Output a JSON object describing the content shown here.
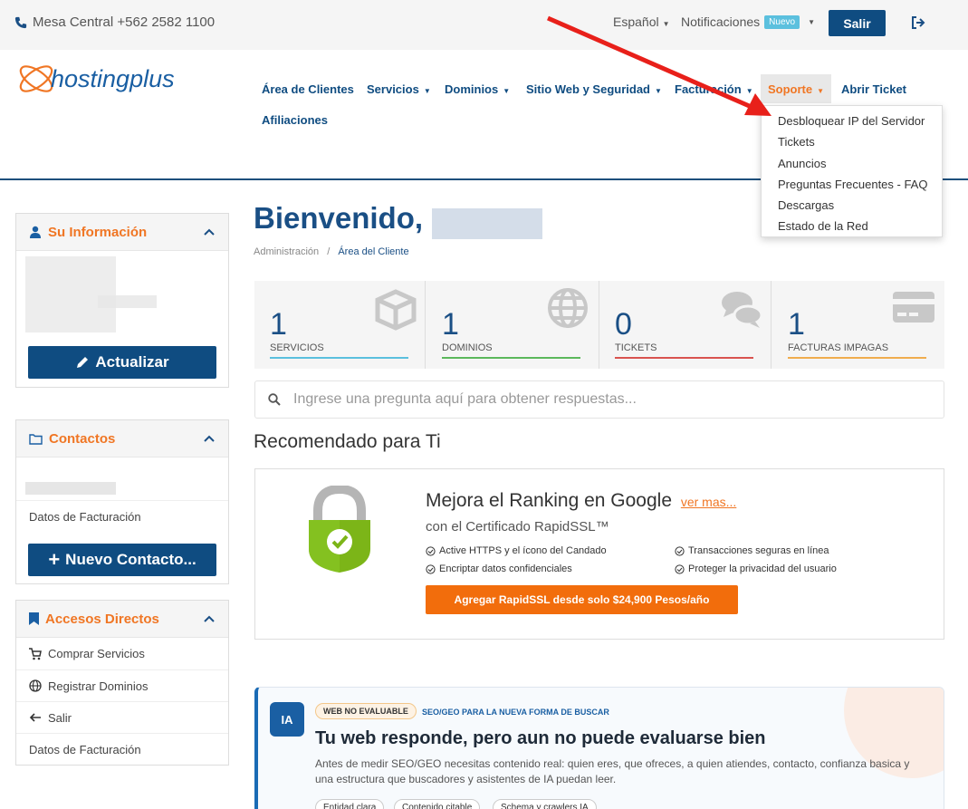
{
  "topbar": {
    "phone": "Mesa Central +562 2582 1100",
    "language": "Español",
    "notifications": "Notificaciones",
    "badge": "Nuevo",
    "logout_button": "Salir"
  },
  "brand": {
    "logo_text": "hostingplus",
    "logo_color": "#f07624"
  },
  "nav": {
    "items": [
      "Área de Clientes",
      "Servicios",
      "Dominios",
      "Sitio Web y Seguridad",
      "Facturación",
      "Soporte",
      "Abrir Ticket",
      "Afiliaciones"
    ],
    "active": "Soporte"
  },
  "dropdown": {
    "items": [
      "Desbloquear IP del Servidor",
      "Tickets",
      "Anuncios",
      "Preguntas Frecuentes - FAQ",
      "Descargas",
      "Estado de la Red"
    ]
  },
  "sidebar": {
    "info": {
      "title": "Su Información",
      "button": "Actualizar"
    },
    "contacts": {
      "title": "Contactos",
      "link": "Datos de Facturación",
      "button": "Nuevo Contacto..."
    },
    "shortcuts": {
      "title": "Accesos Directos",
      "items": [
        "Comprar Servicios",
        "Registrar Dominios",
        "Salir",
        "Datos de Facturación"
      ]
    }
  },
  "main": {
    "welcome": "Bienvenido,",
    "breadcrumb": [
      "Administración",
      "Área del Cliente"
    ],
    "stats": [
      {
        "value": "1",
        "label": "SERVICIOS",
        "color": "#5bc0de"
      },
      {
        "value": "1",
        "label": "DOMINIOS",
        "color": "#5cb85c"
      },
      {
        "value": "0",
        "label": "TICKETS",
        "color": "#d9534f"
      },
      {
        "value": "1",
        "label": "FACTURAS IMPAGAS",
        "color": "#f0ad4e"
      }
    ],
    "search_placeholder": "Ingrese una pregunta aquí para obtener respuestas...",
    "recommended": "Recomendado para Ti",
    "promo": {
      "title": "Mejora el Ranking en Google",
      "link": "ver mas...",
      "subtitle": "con el Certificado RapidSSL™",
      "features": [
        "Active HTTPS y el ícono del Candado",
        "Transacciones seguras en línea",
        "Encriptar datos confidenciales",
        "Proteger la privacidad del usuario"
      ],
      "button": "Agregar RapidSSL desde solo $24,900 Pesos/año"
    },
    "ia": {
      "icon_text": "IA",
      "badge": "WEB NO EVALUABLE",
      "kicker": "SEO/GEO PARA LA NUEVA FORMA DE BUSCAR",
      "title": "Tu web responde, pero aun no puede evaluarse bien",
      "description": "Antes de medir SEO/GEO necesitas contenido real: quien eres, que ofreces, a quien atiendes, contacto, confianza basica y una estructura que buscadores y asistentes de IA puedan leer.",
      "chips": [
        "Entidad clara",
        "Contenido citable",
        "Schema y crawlers IA"
      ]
    }
  }
}
